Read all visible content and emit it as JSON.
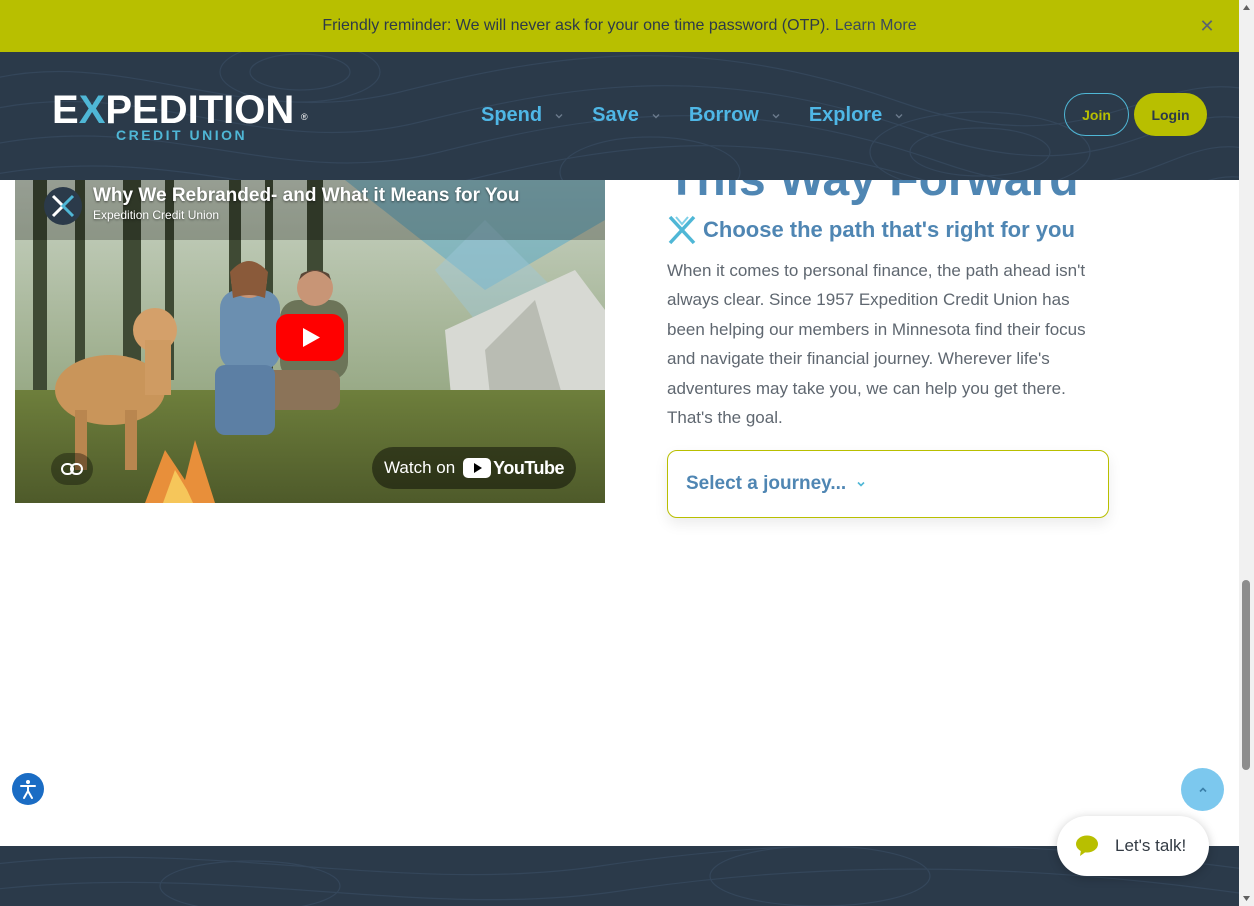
{
  "alert": {
    "message": "Friendly reminder: We will never ask for your one time password (OTP).",
    "link_label": "Learn More",
    "close_glyph": "✕"
  },
  "brand": {
    "name_part1": "E",
    "name_x": "X",
    "name_part2": "PEDITION",
    "subtitle": "CREDIT UNION",
    "registered": "®"
  },
  "nav": {
    "items": [
      {
        "label": "Spend"
      },
      {
        "label": "Save"
      },
      {
        "label": "Borrow"
      },
      {
        "label": "Explore"
      }
    ],
    "join_label": "Join",
    "login_label": "Login"
  },
  "video": {
    "title": "Why We Rebranded- and What it Means for You",
    "channel": "Expedition Credit Union",
    "watch_on": "Watch on",
    "platform": "YouTube"
  },
  "content": {
    "heading": "This Way Forward",
    "subheading": "Choose the path that's right for you",
    "body": "When it comes to personal finance, the path ahead isn't always clear. Since 1957 Expedition Credit Union has been helping our members in Minnesota find their focus and navigate their financial journey. Wherever life's adventures may take you, we can help you get there. That's the goal.",
    "journey_select": "Select a journey..."
  },
  "chat": {
    "label": "Let's talk!"
  },
  "colors": {
    "brand_lime": "#b8bf00",
    "brand_navy": "#2b3a4a",
    "brand_blue": "#4fb7d6",
    "heading_blue": "#4f86b3"
  }
}
